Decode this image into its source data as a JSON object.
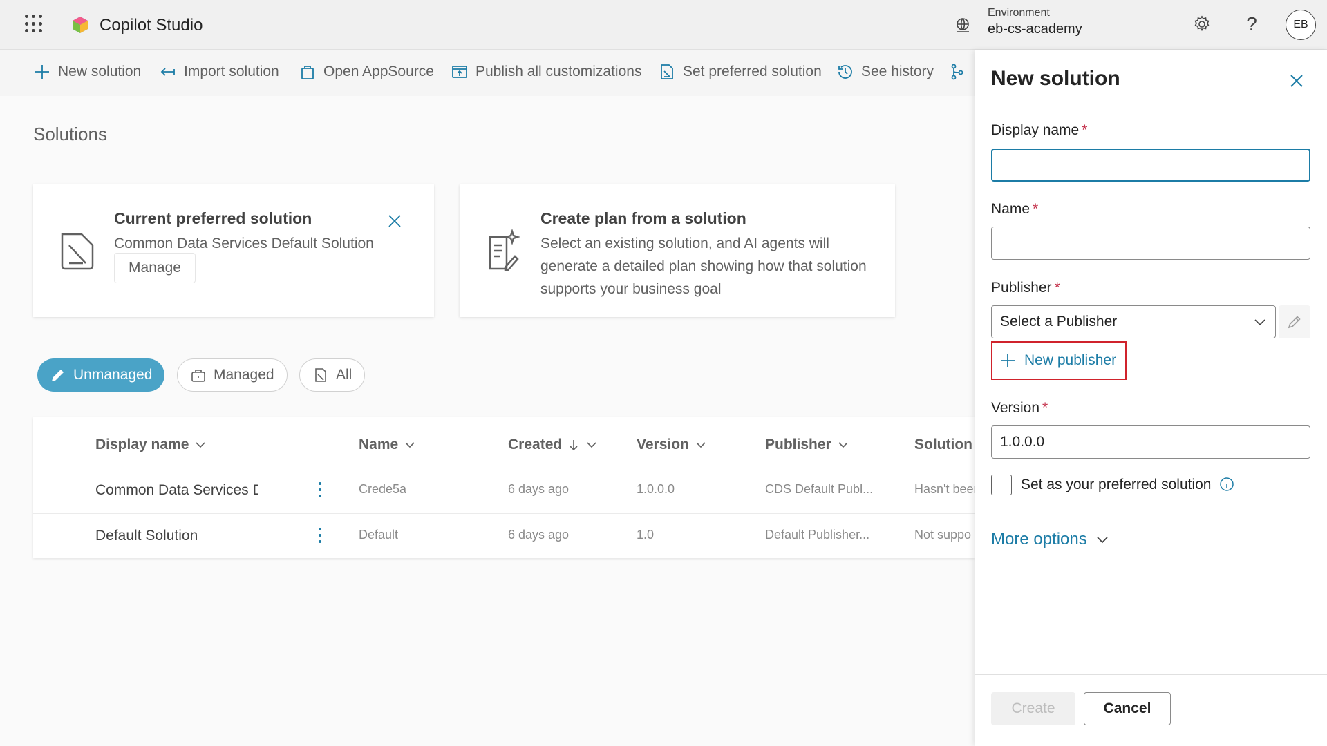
{
  "header": {
    "app_title": "Copilot Studio",
    "environment_label": "Environment",
    "environment_value": "eb-cs-academy",
    "avatar_initials": "EB"
  },
  "commands": {
    "new_solution": "New solution",
    "import_solution": "Import solution",
    "open_appsource": "Open AppSource",
    "publish_all": "Publish all customizations",
    "set_preferred": "Set preferred solution",
    "see_history": "See history"
  },
  "page": {
    "title": "Solutions"
  },
  "preferred_card": {
    "title": "Current preferred solution",
    "subtitle": "Common Data Services Default Solution",
    "manage_label": "Manage"
  },
  "plan_card": {
    "title": "Create plan from a solution",
    "description": "Select an existing solution, and AI agents will generate a detailed plan showing how that solution supports your business goal"
  },
  "filters": {
    "unmanaged": "Unmanaged",
    "managed": "Managed",
    "all": "All"
  },
  "table": {
    "columns": {
      "display_name": "Display name",
      "name": "Name",
      "created": "Created",
      "version": "Version",
      "publisher": "Publisher",
      "solution": "Solution"
    },
    "rows": [
      {
        "display_name": "Common Data Services De",
        "name": "Crede5a",
        "created": "6 days ago",
        "version": "1.0.0.0",
        "publisher": "CDS Default Publ...",
        "status": "Hasn't been"
      },
      {
        "display_name": "Default Solution",
        "name": "Default",
        "created": "6 days ago",
        "version": "1.0",
        "publisher": "Default Publisher...",
        "status": "Not suppo"
      }
    ]
  },
  "panel": {
    "title": "New solution",
    "display_name_label": "Display name",
    "display_name_value": "",
    "name_label": "Name",
    "name_value": "",
    "publisher_label": "Publisher",
    "publisher_placeholder": "Select a Publisher",
    "new_publisher": "New publisher",
    "version_label": "Version",
    "version_value": "1.0.0.0",
    "preferred_checkbox_label": "Set as your preferred solution",
    "more_options": "More options",
    "create_label": "Create",
    "cancel_label": "Cancel",
    "required_marker": "*"
  },
  "colors": {
    "accent": "#1c7ca6",
    "pill_active": "#4aa3c7",
    "highlight_border": "#d0232c",
    "required": "#c4314b"
  }
}
